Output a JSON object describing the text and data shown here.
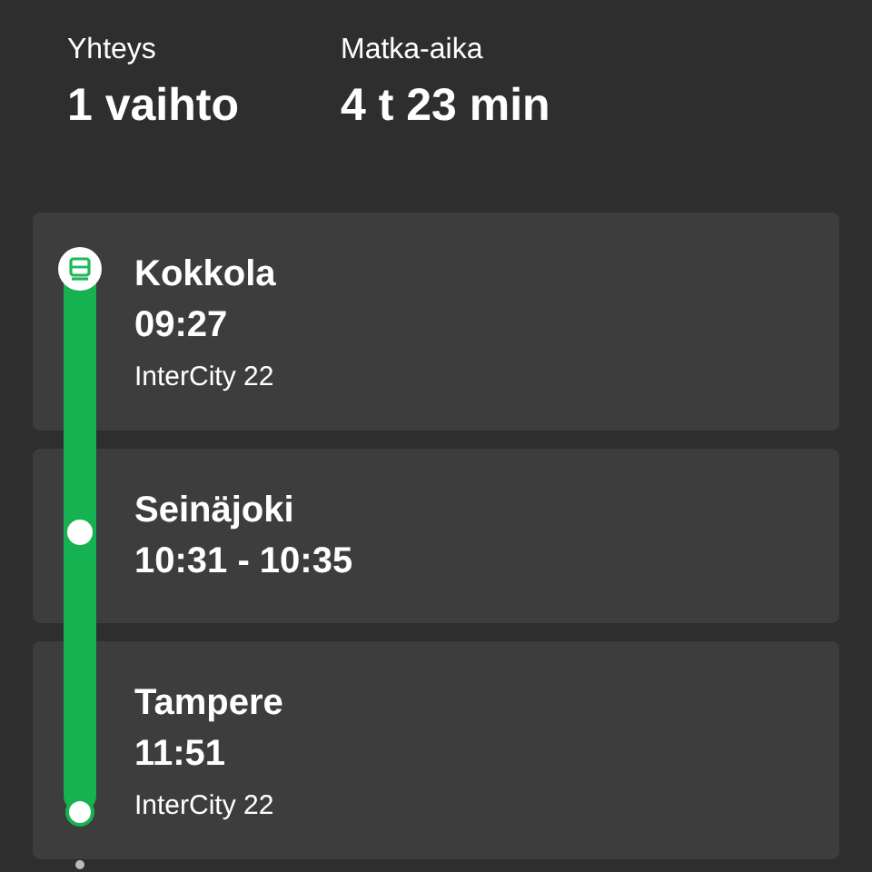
{
  "summary": [
    {
      "label": "Yhteys",
      "value": "1 vaihto"
    },
    {
      "label": "Matka-aika",
      "value": "4 t 23 min"
    }
  ],
  "stops": [
    {
      "kind": "start",
      "name": "Kokkola",
      "time": "09:27",
      "train": "InterCity 22"
    },
    {
      "kind": "transfer",
      "name": "Seinäjoki",
      "time": "10:31 - 10:35"
    },
    {
      "kind": "end",
      "name": "Tampere",
      "time": "11:51",
      "train": "InterCity 22"
    }
  ]
}
